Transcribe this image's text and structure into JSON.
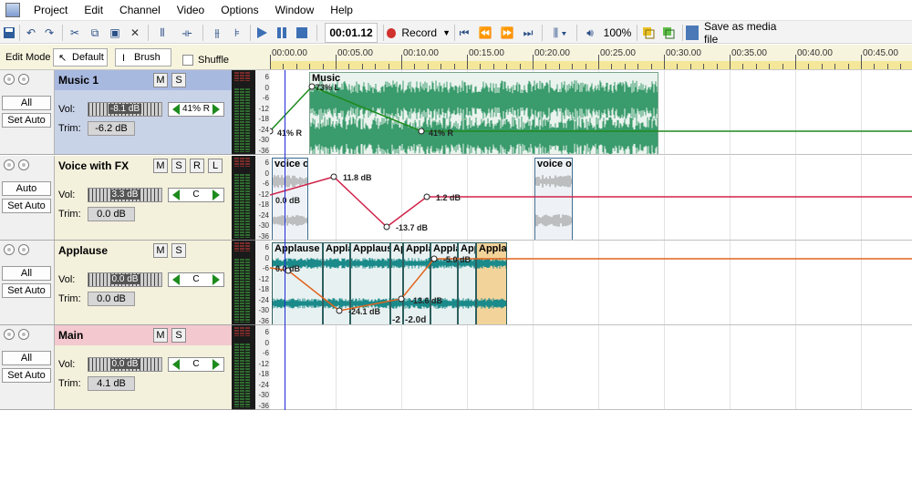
{
  "menu": [
    "Project",
    "Edit",
    "Channel",
    "Video",
    "Options",
    "Window",
    "Help"
  ],
  "toolbar": {
    "time": "00:01.12",
    "record_label": "Record",
    "zoom": "100%",
    "save_label": "Save as media file",
    "icons": [
      "save-icon",
      "undo-icon",
      "redo-icon",
      "cut-icon",
      "copy-icon",
      "paste-icon",
      "delete-icon",
      "split-icon",
      "trim-icon",
      "join-icon",
      "snap-icon",
      "play-icon",
      "pause-icon",
      "stop-icon",
      "record-icon",
      "go-start-icon",
      "rewind-icon",
      "forward-icon",
      "go-end-icon",
      "grid-icon",
      "volume-icon",
      "track-color-icon",
      "track-group-icon",
      "media-file-icon"
    ]
  },
  "editbar": {
    "label": "Edit Mode",
    "default_label": "Default",
    "brush_label": "Brush",
    "shuffle_label": "Shuffle"
  },
  "ruler": {
    "labels": [
      "00:00.00",
      "00:05.00",
      "00:10.00",
      "00:15.00",
      "00:20.00",
      "00:25.00",
      "00:30.00",
      "00:35.00",
      "00:40.00",
      "00:45.00"
    ]
  },
  "db_scale": [
    "6",
    "0",
    "-6",
    "-12",
    "-18",
    "-24",
    "-30",
    "-36"
  ],
  "tracks": [
    {
      "name": "Music 1",
      "header_color": "#a8b9e0",
      "body_color": "#c9d3e8",
      "buttons": [
        "M",
        "S"
      ],
      "left_btn1": "All",
      "left_btn2": "Set Auto",
      "vol_label": "Vol:",
      "vol_value": "-8.1 dB",
      "pan_value": "41% R",
      "trim_label": "Trim:",
      "trim_value": "-6.2 dB"
    },
    {
      "name": "Voice with FX",
      "header_color": "#f3f0dc",
      "body_color": "#f3f0dc",
      "buttons": [
        "M",
        "S",
        "R",
        "L"
      ],
      "left_btn1": "Auto",
      "left_btn2": "Set Auto",
      "vol_label": "Vol:",
      "vol_value": "3.3 dB",
      "pan_value": "C",
      "trim_label": "Trim:",
      "trim_value": "0.0 dB"
    },
    {
      "name": "Applause",
      "header_color": "#f3f0dc",
      "body_color": "#f3f0dc",
      "buttons": [
        "M",
        "S"
      ],
      "left_btn1": "All",
      "left_btn2": "Set Auto",
      "vol_label": "Vol:",
      "vol_value": "0.0 dB",
      "pan_value": "C",
      "trim_label": "Trim:",
      "trim_value": "0.0 dB"
    },
    {
      "name": "Main",
      "header_color": "#f3c8cf",
      "body_color": "#f3f0dc",
      "buttons": [
        "M",
        "S"
      ],
      "left_btn1": "All",
      "left_btn2": "Set Auto",
      "vol_label": "Vol:",
      "vol_value": "0.0 dB",
      "pan_value": "C",
      "trim_label": "Trim:",
      "trim_value": "4.1 dB"
    }
  ],
  "lanes": {
    "music": {
      "clip_title": "Music",
      "labels": [
        "73% L",
        "41% R",
        "41% R"
      ]
    },
    "voice": {
      "clip_title_1": "voice ov",
      "clip_title_2": "voice ov",
      "labels": [
        "0.0 dB",
        "11.8 dB",
        "-13.7 dB",
        "1.2 dB"
      ]
    },
    "applause": {
      "clip_titles": [
        "Applause",
        "Appla",
        "Applause",
        "Ap",
        "Appla",
        "Appla",
        "Applause",
        "Applause"
      ],
      "labels": [
        "0.0 dB",
        "-24.1 dB",
        "-2",
        "-2.0d",
        "-13.6 dB",
        "-5.0 dB"
      ]
    }
  },
  "colors": {
    "music_wave": "#3a9b6c",
    "music_env": "#1d8a1d",
    "voice_env": "#d0234a",
    "applause_wave": "#1b8a8a",
    "applause_env": "#e2631d",
    "playhead": "#1f2bd8"
  }
}
